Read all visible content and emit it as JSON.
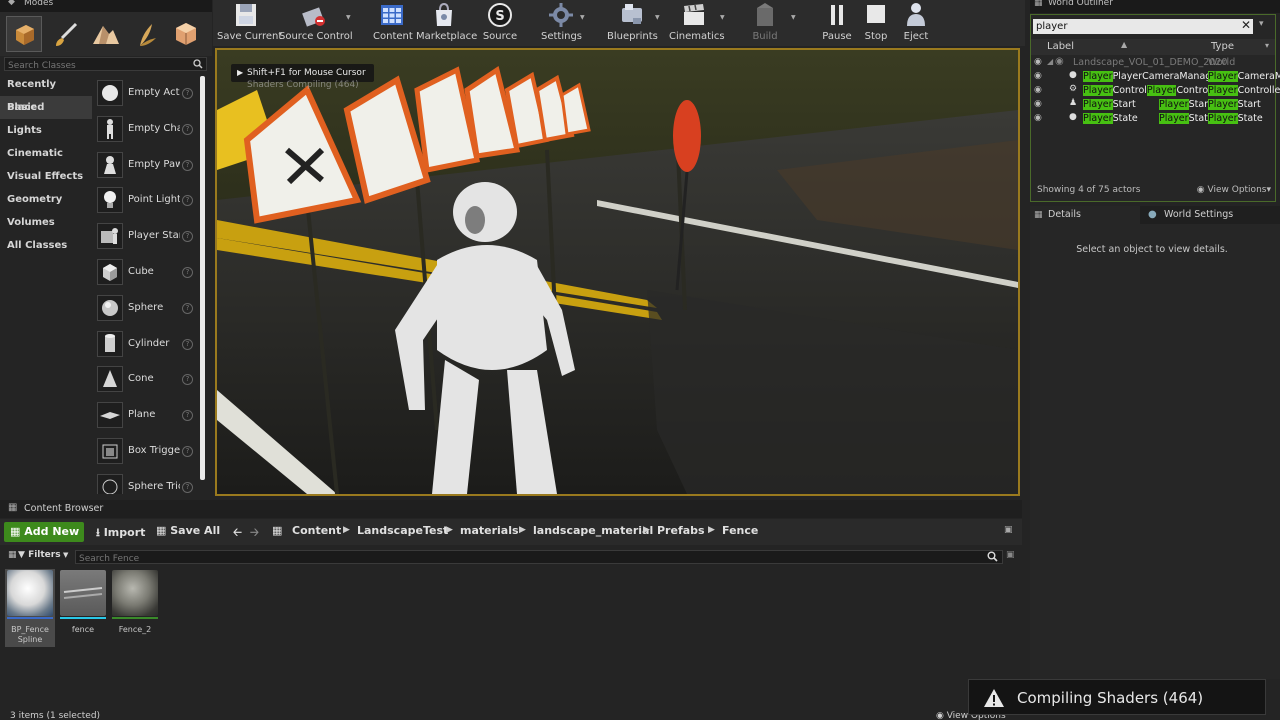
{
  "modes": {
    "tab_label": "Modes",
    "search_placeholder": "Search Classes",
    "categories": [
      "Recently Placed",
      "Basic",
      "Lights",
      "Cinematic",
      "Visual Effects",
      "Geometry",
      "Volumes",
      "All Classes"
    ],
    "selected_category": "Basic",
    "items": [
      {
        "label": "Empty Acto",
        "icon": "sphere-white-icon"
      },
      {
        "label": "Empty Char",
        "icon": "mannequin-icon"
      },
      {
        "label": "Empty Paw",
        "icon": "pawn-icon"
      },
      {
        "label": "Point Light",
        "icon": "bulb-icon"
      },
      {
        "label": "Player Star",
        "icon": "player-start-icon"
      },
      {
        "label": "Cube",
        "icon": "cube-icon"
      },
      {
        "label": "Sphere",
        "icon": "sphere-icon"
      },
      {
        "label": "Cylinder",
        "icon": "cylinder-icon"
      },
      {
        "label": "Cone",
        "icon": "cone-icon"
      },
      {
        "label": "Plane",
        "icon": "plane-icon"
      },
      {
        "label": "Box Trigge",
        "icon": "box-trigger-icon"
      },
      {
        "label": "Sphere Tric",
        "icon": "sphere-trigger-icon"
      }
    ]
  },
  "toolbar": {
    "save_current": "Save Current",
    "source_control": "Source Control",
    "content": "Content",
    "marketplace": "Marketplace",
    "source": "Source",
    "settings": "Settings",
    "blueprints": "Blueprints",
    "cinematics": "Cinematics",
    "build": "Build",
    "pause": "Pause",
    "stop": "Stop",
    "eject": "Eject"
  },
  "viewport": {
    "tooltip": "Shift+F1 for Mouse Cursor",
    "overlay_text": "Shaders Compiling (464)"
  },
  "outliner": {
    "tab_label": "World Outliner",
    "search_value": "player",
    "col_label": "Label",
    "col_type": "Type",
    "root": {
      "name": "Landscape_VOL_01_DEMO_2020",
      "type": "World"
    },
    "rows": [
      {
        "hl": "Player",
        "rest": "PlayerCameraManager",
        "type_hl": "Player",
        "type_rest": "CameraM"
      },
      {
        "hl": "Player",
        "rest": "Control",
        "hl2": "Player",
        "rest2": "Controller",
        "type_hl": "Player",
        "type_rest": "Controller"
      },
      {
        "hl": "Player",
        "rest": "Start",
        "mid_hl": "Player",
        "mid_rest": "Start",
        "type_hl": "Player",
        "type_rest": "Start"
      },
      {
        "hl": "Player",
        "rest": "State",
        "mid_hl": "Player",
        "mid_rest": "State",
        "type_hl": "Player",
        "type_rest": "State"
      }
    ],
    "showing": "Showing 4 of 75 actors",
    "view_options": "View Options"
  },
  "details": {
    "tab_details": "Details",
    "tab_world_settings": "World Settings",
    "empty_message": "Select an object to view details."
  },
  "content_browser": {
    "tab_label": "Content Browser",
    "add_new": "Add New",
    "import": "Import",
    "save_all": "Save All",
    "breadcrumbs": [
      "Content",
      "LandscapeTest",
      "materials",
      "landscape_material",
      "Prefabs",
      "Fence"
    ],
    "filters": "Filters",
    "search_placeholder": "Search Fence",
    "assets": [
      {
        "label": "BP_Fence Spline",
        "selected": true
      },
      {
        "label": "fence",
        "selected": false
      },
      {
        "label": "Fence_2",
        "selected": false
      }
    ],
    "status": "3 items (1 selected)",
    "view_options": "View Options"
  },
  "notification": {
    "text": "Compiling Shaders (464)"
  },
  "colors": {
    "accent_green": "#47c012",
    "add_new_green": "#3d8a1c",
    "viewport_border": "#9a7a1e"
  }
}
